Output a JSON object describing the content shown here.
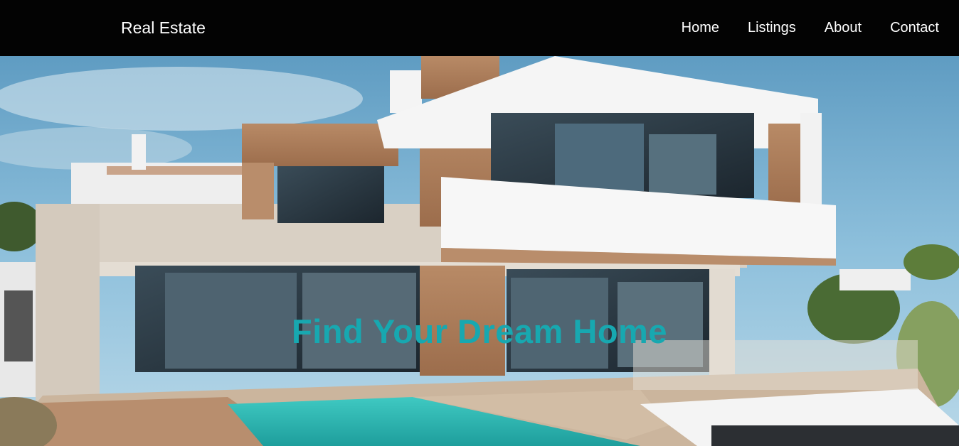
{
  "brand": "Real Estate",
  "nav": {
    "items": [
      {
        "label": "Home"
      },
      {
        "label": "Listings"
      },
      {
        "label": "About"
      },
      {
        "label": "Contact"
      }
    ]
  },
  "hero": {
    "title": "Find Your Dream Home",
    "title_color": "#17a8b0"
  },
  "colors": {
    "navbar": "#030303",
    "nav_text": "#ffffff"
  }
}
